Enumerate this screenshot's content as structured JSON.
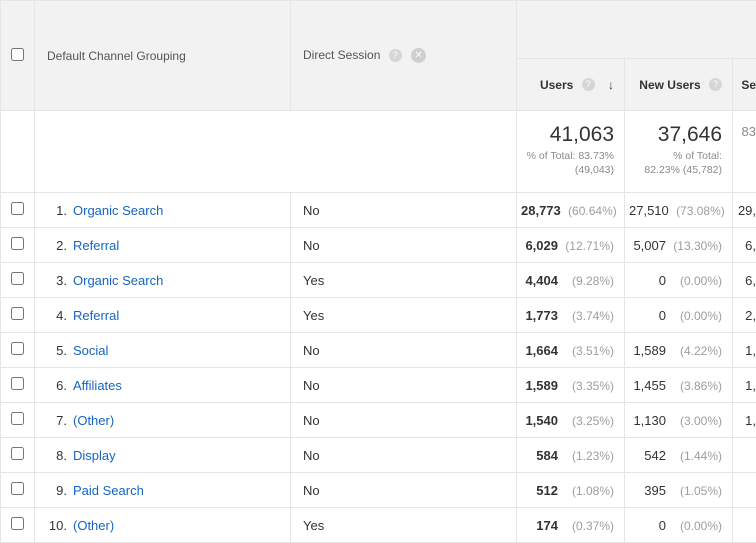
{
  "header": {
    "dim1_label": "Default Channel Grouping",
    "dim2_label": "Direct Session",
    "col_users": "Users",
    "col_new_users": "New Users",
    "col_sessions_frag": "Se"
  },
  "summary": {
    "users_total": "41,063",
    "users_sub1": "% of Total: 83.73%",
    "users_sub2": "(49,043)",
    "new_users_total": "37,646",
    "new_users_sub1": "% of Total:",
    "new_users_sub2": "82.23% (45,782)",
    "sessions_frag": "83"
  },
  "rows": [
    {
      "idx": "1.",
      "channel": "Organic Search",
      "direct": "No",
      "users_val": "28,773",
      "users_pct": "(60.64%)",
      "nu_val": "27,510",
      "nu_pct": "(73.08%)",
      "sess_frag": "29,"
    },
    {
      "idx": "2.",
      "channel": "Referral",
      "direct": "No",
      "users_val": "6,029",
      "users_pct": "(12.71%)",
      "nu_val": "5,007",
      "nu_pct": "(13.30%)",
      "sess_frag": "6,"
    },
    {
      "idx": "3.",
      "channel": "Organic Search",
      "direct": "Yes",
      "users_val": "4,404",
      "users_pct": "(9.28%)",
      "nu_val": "0",
      "nu_pct": "(0.00%)",
      "sess_frag": "6,"
    },
    {
      "idx": "4.",
      "channel": "Referral",
      "direct": "Yes",
      "users_val": "1,773",
      "users_pct": "(3.74%)",
      "nu_val": "0",
      "nu_pct": "(0.00%)",
      "sess_frag": "2,"
    },
    {
      "idx": "5.",
      "channel": "Social",
      "direct": "No",
      "users_val": "1,664",
      "users_pct": "(3.51%)",
      "nu_val": "1,589",
      "nu_pct": "(4.22%)",
      "sess_frag": "1,"
    },
    {
      "idx": "6.",
      "channel": "Affiliates",
      "direct": "No",
      "users_val": "1,589",
      "users_pct": "(3.35%)",
      "nu_val": "1,455",
      "nu_pct": "(3.86%)",
      "sess_frag": "1,"
    },
    {
      "idx": "7.",
      "channel": "(Other)",
      "direct": "No",
      "users_val": "1,540",
      "users_pct": "(3.25%)",
      "nu_val": "1,130",
      "nu_pct": "(3.00%)",
      "sess_frag": "1,"
    },
    {
      "idx": "8.",
      "channel": "Display",
      "direct": "No",
      "users_val": "584",
      "users_pct": "(1.23%)",
      "nu_val": "542",
      "nu_pct": "(1.44%)",
      "sess_frag": ""
    },
    {
      "idx": "9.",
      "channel": "Paid Search",
      "direct": "No",
      "users_val": "512",
      "users_pct": "(1.08%)",
      "nu_val": "395",
      "nu_pct": "(1.05%)",
      "sess_frag": ""
    },
    {
      "idx": "10.",
      "channel": "(Other)",
      "direct": "Yes",
      "users_val": "174",
      "users_pct": "(0.37%)",
      "nu_val": "0",
      "nu_pct": "(0.00%)",
      "sess_frag": ""
    }
  ]
}
